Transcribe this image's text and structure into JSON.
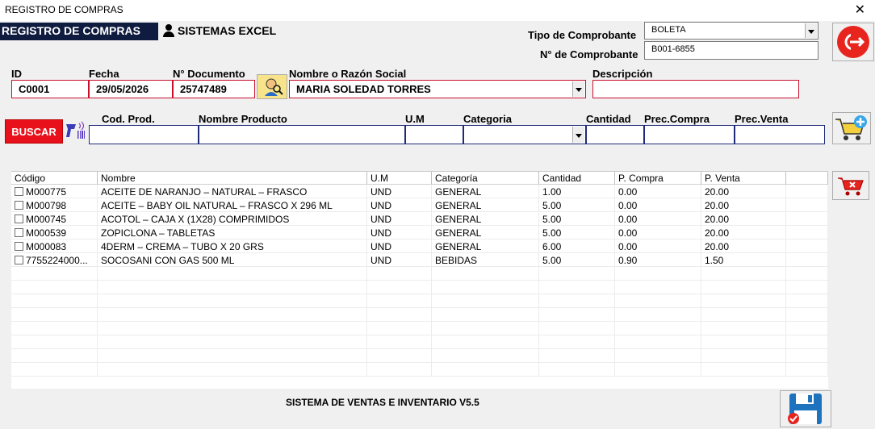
{
  "window": {
    "title": "REGISTRO DE COMPRAS",
    "close_glyph": "✕"
  },
  "header": {
    "brand": "REGISTRO DE COMPRAS",
    "system": "SISTEMAS EXCEL"
  },
  "comprobante": {
    "tipo_label": "Tipo de Comprobante",
    "tipo_value": "BOLETA",
    "numero_label": "N° de Comprobante",
    "numero_value": "B001-6855"
  },
  "cliente": {
    "id_label": "ID",
    "id_value": "C0001",
    "fecha_label": "Fecha",
    "fecha_value": "29/05/2026",
    "doc_label": "N° Documento",
    "doc_value": "25747489",
    "nombre_label": "Nombre o Razón Social",
    "nombre_value": "MARIA SOLEDAD TORRES",
    "descripcion_label": "Descripción",
    "descripcion_value": ""
  },
  "producto": {
    "buscar_label": "BUSCAR",
    "cod_label": "Cod. Prod.",
    "cod_value": "",
    "nombre_label": "Nombre Producto",
    "nombre_value": "",
    "um_label": "U.M",
    "um_value": "",
    "categoria_label": "Categoria",
    "categoria_value": "",
    "cantidad_label": "Cantidad",
    "cantidad_value": "",
    "compra_label": "Prec.Compra",
    "compra_value": "",
    "venta_label": "Prec.Venta",
    "venta_value": ""
  },
  "table": {
    "columns": [
      "Código",
      "Nombre",
      "U.M",
      "Categoría",
      "Cantidad",
      "P. Compra",
      "P. Venta",
      ""
    ],
    "rows": [
      [
        "M000775",
        "ACEITE DE NARANJO – NATURAL – FRASCO",
        "UND",
        "GENERAL",
        "1.00",
        "0.00",
        "20.00",
        ""
      ],
      [
        "M000798",
        "ACEITE – BABY OIL NATURAL – FRASCO X 296 ML",
        "UND",
        "GENERAL",
        "5.00",
        "0.00",
        "20.00",
        ""
      ],
      [
        "M000745",
        "ACOTOL – CAJA X (1X28) COMPRIMIDOS",
        "UND",
        "GENERAL",
        "5.00",
        "0.00",
        "20.00",
        ""
      ],
      [
        "M000539",
        "ZOPICLONA – TABLETAS",
        "UND",
        "GENERAL",
        "5.00",
        "0.00",
        "20.00",
        ""
      ],
      [
        "M000083",
        "4DERM – CREMA – TUBO X 20 GRS",
        "UND",
        "GENERAL",
        "6.00",
        "0.00",
        "20.00",
        ""
      ],
      [
        "7755224000...",
        "SOCOSANI CON GAS 500 ML",
        "UND",
        "BEBIDAS",
        "5.00",
        "0.90",
        "1.50",
        ""
      ]
    ],
    "empty_rows": 8
  },
  "footer": {
    "text": "SISTEMA DE VENTAS E INVENTARIO V5.5"
  },
  "colors": {
    "accent_red": "#e8111b",
    "brand_navy": "#0f1c3f",
    "field_red": "#c8102e",
    "field_blue": "#1f2a7a"
  }
}
